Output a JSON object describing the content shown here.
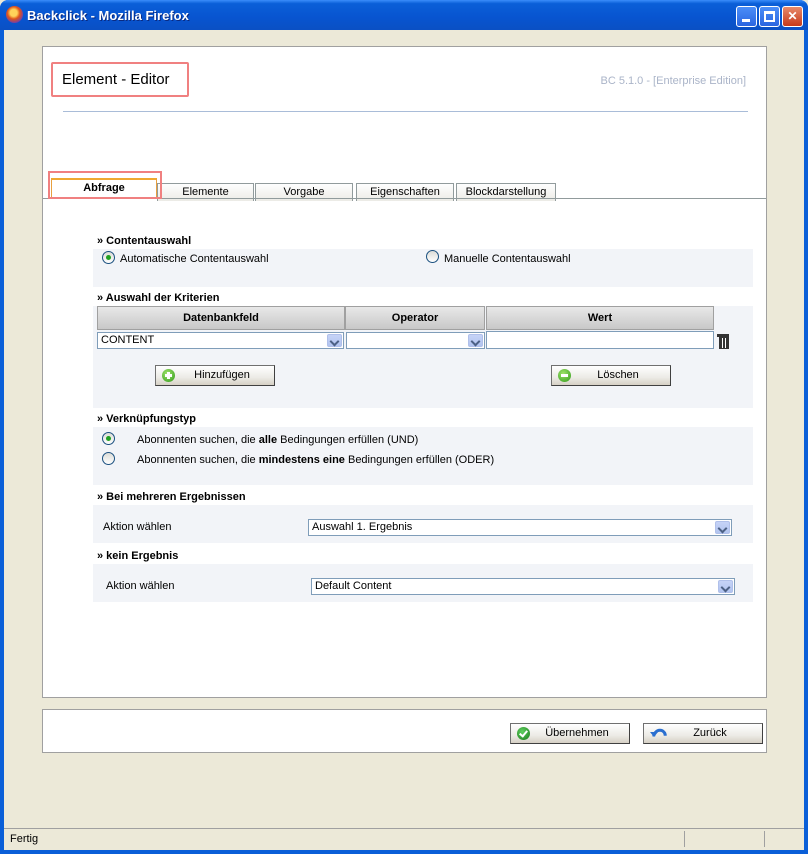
{
  "window": {
    "title": "Backclick - Mozilla Firefox"
  },
  "header": {
    "title": "Element - Editor",
    "version": "BC 5.1.0 - [Enterprise Edition]"
  },
  "tabs": [
    {
      "label": "Abfrage",
      "active": true
    },
    {
      "label": "Elemente"
    },
    {
      "label": "Vorgabe"
    },
    {
      "label": "Eigenschaften"
    },
    {
      "label": "Blockdarstellung"
    }
  ],
  "content_selection": {
    "title": "» Contentauswahl",
    "auto_label": "Automatische Contentauswahl",
    "manual_label": "Manuelle Contentauswahl",
    "selected": "auto"
  },
  "criteria": {
    "title": "» Auswahl der Kriterien",
    "columns": [
      "Datenbankfeld",
      "Operator",
      "Wert"
    ],
    "row": {
      "field": "CONTENT",
      "operator": "",
      "value": ""
    },
    "add_label": "Hinzufügen",
    "delete_label": "Löschen"
  },
  "link_type": {
    "title": "» Verknüpfungstyp",
    "option_and_pre": "Abonnenten suchen, die ",
    "option_and_bold": "alle",
    "option_and_post": " Bedingungen erfüllen (UND)",
    "option_or_pre": "Abonnenten suchen, die ",
    "option_or_bold": "mindestens eine",
    "option_or_post": " Bedingungen erfüllen (ODER)",
    "selected": "and"
  },
  "multiple_results": {
    "title": "» Bei mehreren Ergebnissen",
    "action_label": "Aktion wählen",
    "value": "Auswahl 1. Ergebnis"
  },
  "no_result": {
    "title": "» kein Ergebnis",
    "action_label": "Aktion wählen",
    "value": "Default Content"
  },
  "footer": {
    "apply_label": "Übernehmen",
    "back_label": "Zurück"
  },
  "status": {
    "text": "Fertig"
  }
}
